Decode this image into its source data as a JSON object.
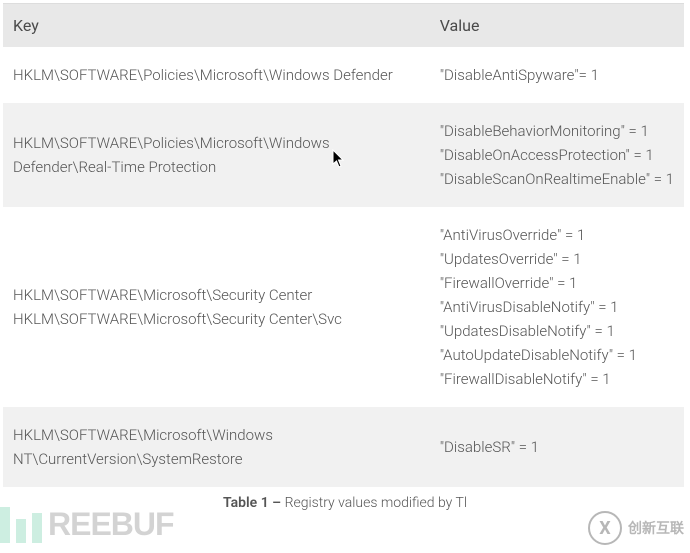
{
  "headers": {
    "key": "Key",
    "value": "Value"
  },
  "rows": [
    {
      "keys": [
        "HKLM\\SOFTWARE\\Policies\\Microsoft\\Windows Defender"
      ],
      "values": [
        "\"DisableAntiSpyware\"= 1"
      ]
    },
    {
      "keys": [
        "HKLM\\SOFTWARE\\Policies\\Microsoft\\Windows Defender\\Real-Time Protection"
      ],
      "values": [
        "\"DisableBehaviorMonitoring\" =  1",
        "\"DisableOnAccessProtection\" =  1",
        "\"DisableScanOnRealtimeEnable\" = 1"
      ]
    },
    {
      "keys": [
        "HKLM\\SOFTWARE\\Microsoft\\Security Center",
        "HKLM\\SOFTWARE\\Microsoft\\Security Center\\Svc"
      ],
      "values": [
        "\"AntiVirusOverride\" = 1",
        "\"UpdatesOverride\" = 1",
        "\"FirewallOverride\" = 1",
        "\"AntiVirusDisableNotify\" = 1",
        "\"UpdatesDisableNotify\" = 1",
        "\"AutoUpdateDisableNotify\" = 1",
        "\"FirewallDisableNotify\" = 1"
      ]
    },
    {
      "keys": [
        "HKLM\\SOFTWARE\\Microsoft\\Windows NT\\CurrentVersion\\SystemRestore"
      ],
      "values": [
        "\"DisableSR\" = 1"
      ]
    }
  ],
  "caption_strong": "Table 1 – ",
  "caption_rest": "Registry values modified by Tl",
  "watermarks": {
    "left_text": "REEBUF",
    "right_glyph": "X",
    "right_text": "创新互联"
  }
}
